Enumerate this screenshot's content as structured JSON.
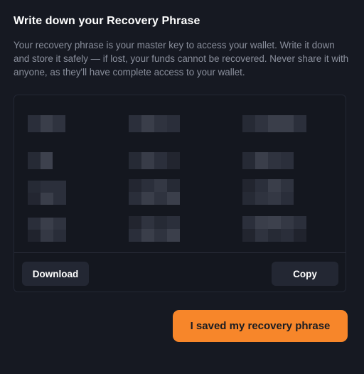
{
  "header": {
    "title": "Write down your Recovery Phrase",
    "description": "Your recovery phrase is your master key to access your wallet. Write it down and store it safely — if lost, your funds cannot be recovered. Never share it with anyone, as they'll have complete access to your wallet."
  },
  "phrase": {
    "word_count": 12,
    "obscured": true
  },
  "actions": {
    "download_label": "Download",
    "copy_label": "Copy",
    "confirm_label": "I saved my recovery phrase"
  },
  "colors": {
    "background": "#161922",
    "accent": "#f7862a",
    "secondary_button": "#232733"
  }
}
